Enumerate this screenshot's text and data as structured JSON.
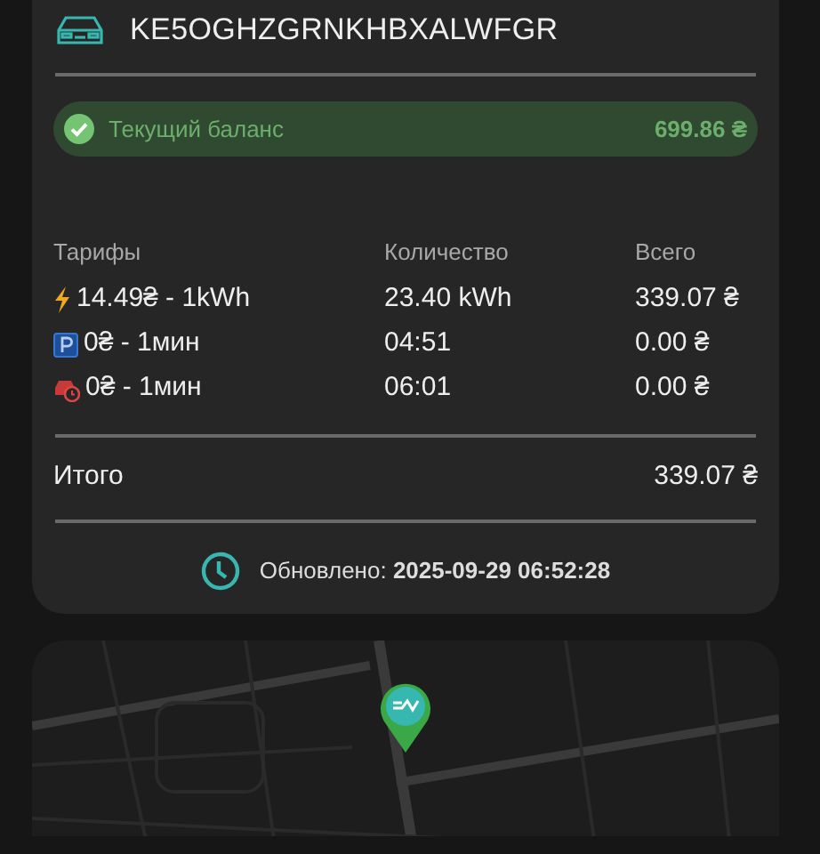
{
  "vehicle": {
    "plate": "KE5OGHZGRNKHBXALWFGR"
  },
  "balance": {
    "label": "Текущий баланс",
    "amount": "699.86 ₴"
  },
  "tariffs": {
    "columns": [
      "Тарифы",
      "Количество",
      "Всего"
    ],
    "rows": [
      {
        "kind": "energy",
        "tariff": "14.49₴ - 1kWh",
        "quantity": "23.40 kWh",
        "total": "339.07 ₴"
      },
      {
        "kind": "parking",
        "tariff": "0₴ - 1мин",
        "quantity": "04:51",
        "total": "0.00 ₴"
      },
      {
        "kind": "idle",
        "tariff": "0₴ - 1мин",
        "quantity": "06:01",
        "total": "0.00 ₴"
      }
    ]
  },
  "summary": {
    "label": "Итого",
    "amount": "339.07 ₴"
  },
  "updated": {
    "label": "Обновлено:",
    "timestamp": "2025-09-29 06:52:28"
  }
}
